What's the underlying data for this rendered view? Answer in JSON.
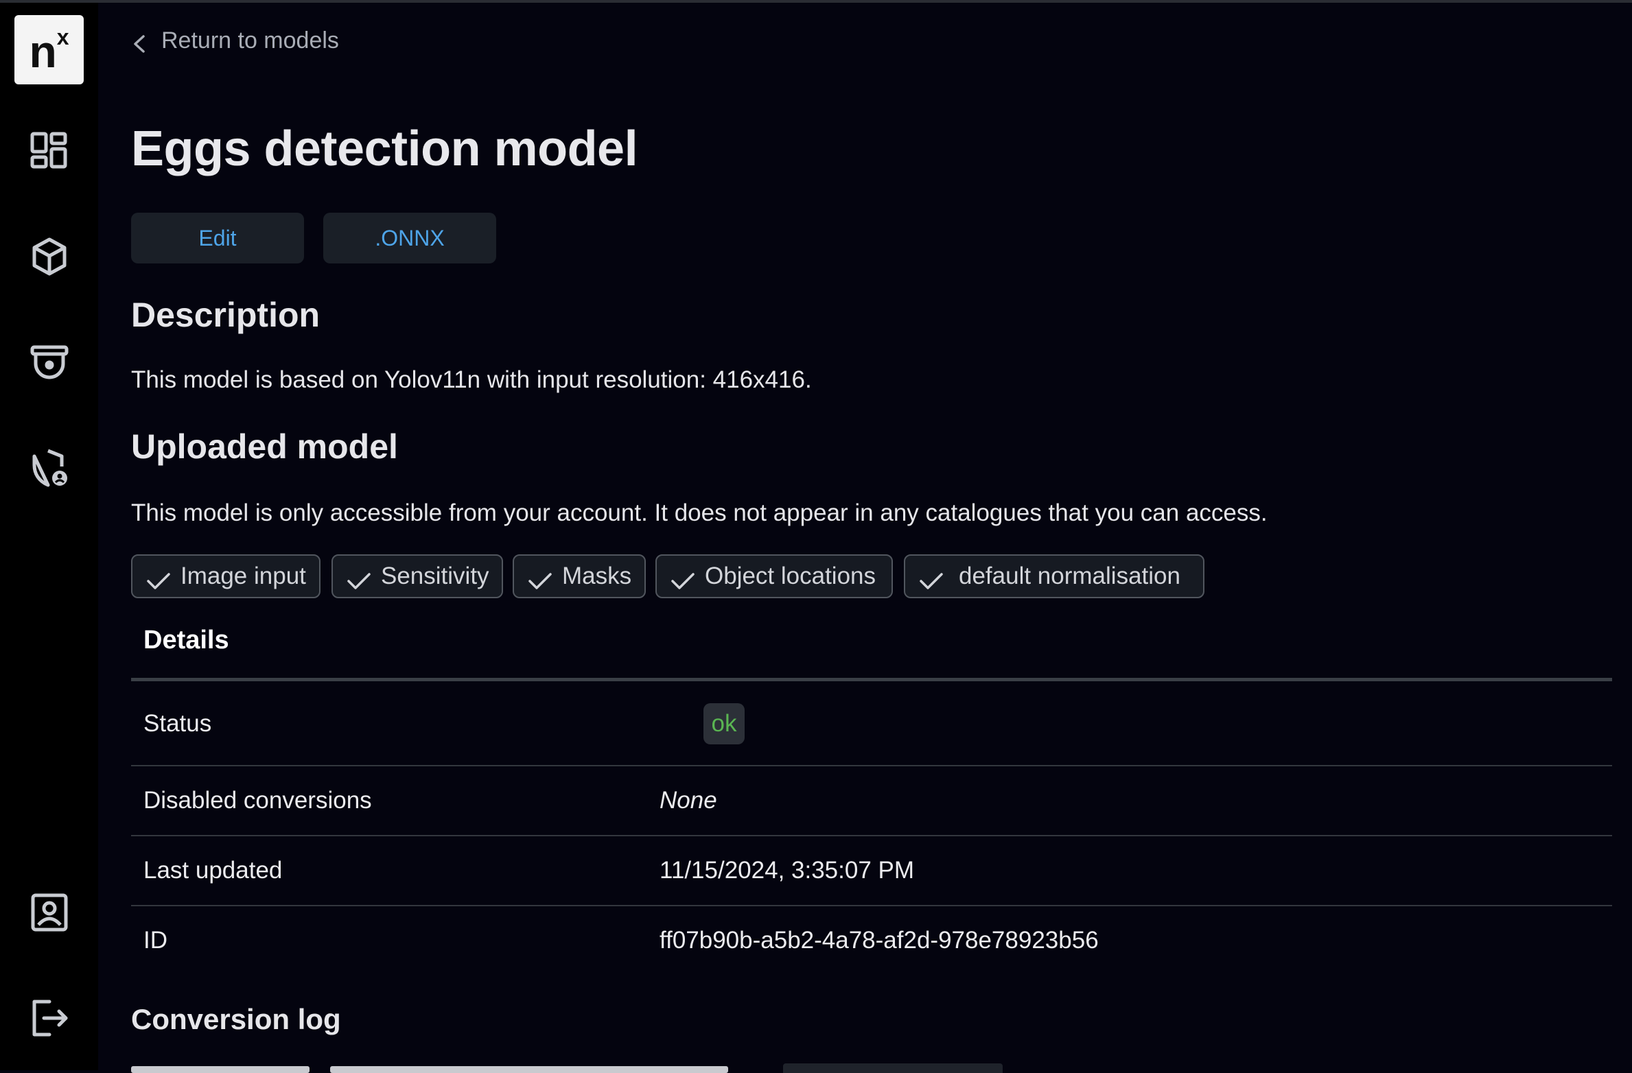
{
  "colors": {
    "background": "#04040f",
    "sidebar": "#000000",
    "accent": "#4ea4e8",
    "status_ok": "#5ab552"
  },
  "sidebar": {
    "logo_main": "n",
    "logo_sup": "x",
    "icons": [
      "dashboard-icon",
      "cube-icon",
      "camera-icon",
      "shield-user-icon",
      "profile-icon",
      "logout-icon"
    ]
  },
  "back_link": "Return to models",
  "title": "Eggs detection model",
  "actions": {
    "edit": "Edit",
    "onnx": ".ONNX"
  },
  "description": {
    "heading": "Description",
    "text": "This model is based on Yolov11n with input resolution: 416x416."
  },
  "uploaded": {
    "heading": "Uploaded model",
    "text": "This model is only accessible from your account. It does not appear in any catalogues that you can access."
  },
  "chips": [
    "Image input",
    "Sensitivity",
    "Masks",
    "Object locations",
    "default normalisation"
  ],
  "details": {
    "heading": "Details",
    "rows": [
      {
        "label": "Status",
        "value": "ok"
      },
      {
        "label": "Disabled conversions",
        "value": "None"
      },
      {
        "label": "Last updated",
        "value": "11/15/2024, 3:35:07 PM"
      },
      {
        "label": "ID",
        "value": "ff07b90b-a5b2-4a78-af2d-978e78923b56"
      }
    ]
  },
  "conversion_log": {
    "heading": "Conversion log"
  }
}
